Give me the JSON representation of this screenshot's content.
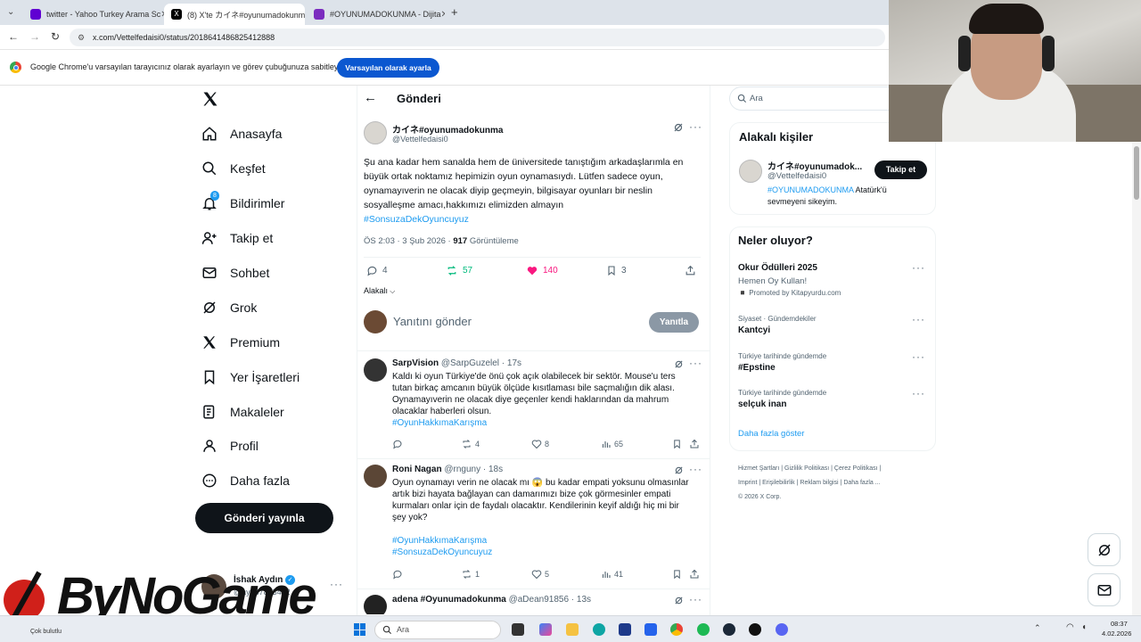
{
  "browser": {
    "tabs": [
      {
        "label": "twitter - Yahoo Turkey Arama Sc",
        "color": "#6001d2"
      },
      {
        "label": "(8) X'te カイネ#oyunumadokunm",
        "color": "#000000"
      },
      {
        "label": "#OYUNUMADOKUNMA - Dijita",
        "color": "#7b2cbf"
      }
    ],
    "url": "x.com/Vettelfedaisi0/status/2018641486825412888",
    "infobar_text": "Google Chrome'u varsayılan tarayıcınız olarak ayarlayın ve görev çubuğunuza sabitleyin",
    "infobar_button": "Varsayılan olarak ayarla"
  },
  "nav": {
    "items": [
      {
        "label": "Anasayfa",
        "icon": "home-icon"
      },
      {
        "label": "Keşfet",
        "icon": "search-icon"
      },
      {
        "label": "Bildirimler",
        "icon": "bell-icon",
        "badge": "8"
      },
      {
        "label": "Takip et",
        "icon": "follow-icon"
      },
      {
        "label": "Sohbet",
        "icon": "mail-icon"
      },
      {
        "label": "Grok",
        "icon": "grok-icon"
      },
      {
        "label": "Premium",
        "icon": "x-icon"
      },
      {
        "label": "Yer İşaretleri",
        "icon": "bookmark-icon"
      },
      {
        "label": "Makaleler",
        "icon": "article-icon"
      },
      {
        "label": "Profil",
        "icon": "person-icon"
      },
      {
        "label": "Daha fazla",
        "icon": "more-icon"
      }
    ],
    "post_button": "Gönderi yayınla",
    "account": {
      "name": "İshak Aydın",
      "handle": "@ayd87893402"
    }
  },
  "main": {
    "header": "Gönderi",
    "post": {
      "name": "カイネ#oyunumadokunma",
      "handle": "@Vettelfedaisi0",
      "text": "Şu ana kadar hem sanalda hem de üniversitede tanıştığım arkadaşlarımla en büyük ortak noktamız hepimizin oyun oynamasıydı. Lütfen sadece oyun, oynamayıverin ne olacak diyip geçmeyin, bilgisayar oyunları bir neslin sosyalleşme amacı,hakkımızı elimizden almayın",
      "hashtag": "#SonsuzaDekOyuncuyuz",
      "time": "ÖS 2:03 · 3 Şub 2026 · ",
      "views": "917",
      "views_label": " Görüntüleme",
      "replies": "4",
      "reposts": "57",
      "likes": "140",
      "bookmarks": "3",
      "related_label": "Alakalı"
    },
    "reply_placeholder": "Yanıtını gönder",
    "reply_button": "Yanıtla",
    "replies": [
      {
        "name": "SarpVision",
        "handle": "@SarpGuzelel · 17s",
        "text": "Kaldı ki oyun Türkiye'de önü çok açık olabilecek bir sektör. Mouse'u ters tutan birkaç amcanın büyük ölçüde kısıtlaması bile saçmalığın dik alası. Oynamayıverin ne olacak diye geçenler kendi haklarından da mahrum olacaklar haberleri olsun.",
        "tags": [
          "#OyunHakkımaKarışma"
        ],
        "replies": "",
        "reposts": "4",
        "likes": "8",
        "views": "65"
      },
      {
        "name": "Roni Nagan",
        "handle": "@rnguny · 18s",
        "text": "Oyun oynamayı verin ne olacak mı 😱 bu kadar empati yoksunu olmasınlar artık bizi hayata bağlayan can damarımızı bize çok görmesinler empati kurmaları onlar için de faydalı olacaktır. Kendilerinin keyif aldığı hiç mi bir şey yok?",
        "tags": [
          "#OyunHakkımaKarışma",
          "#SonsuzaDekOyuncuyuz"
        ],
        "replies": "",
        "reposts": "1",
        "likes": "5",
        "views": "41"
      },
      {
        "name": "adena #Oyunumadokunma",
        "handle": "@aDean91856 · 13s"
      }
    ]
  },
  "right": {
    "search_placeholder": "Ara",
    "related_title": "Alakalı kişiler",
    "person": {
      "name": "カイネ#oyunumadok...",
      "handle": "@Vettelfedaisi0",
      "follow": "Takip et",
      "bio_tag": "#OYUNUMADOKUNMA",
      "bio_text": " Atatürk'ü sevmeyeni sikeyim."
    },
    "trends_title": "Neler oluyor?",
    "trends": [
      {
        "cat": "",
        "title": "Okur Ödülleri 2025",
        "sub": "Hemen Oy Kullan!",
        "promo": "Promoted by Kitapyurdu.com"
      },
      {
        "cat": "Siyaset · Gündemdekiler",
        "title": "Kantcyi"
      },
      {
        "cat": "Türkiye tarihinde gündemde",
        "title": "#Epstine"
      },
      {
        "cat": "Türkiye tarihinde gündemde",
        "title": "selçuk inan"
      }
    ],
    "show_more": "Daha fazla göster",
    "footer": [
      "Hizmet Şartları",
      "Gizlilik Politikası",
      "Çerez Politikası",
      "Imprint",
      "Erişilebilirlik",
      "Reklam bilgisi",
      "Daha fazla ...",
      "© 2026 X Corp."
    ]
  },
  "overlay": {
    "logo_text": "ByNoGame"
  },
  "taskbar": {
    "weather": "Çok bulutlu",
    "search": "Ara",
    "time": "08:37",
    "date": "4.02.2026"
  },
  "colors": {
    "accent": "#1d9bf0",
    "like": "#f91880",
    "repost": "#00ba7c",
    "brand_red": "#d0201a"
  }
}
